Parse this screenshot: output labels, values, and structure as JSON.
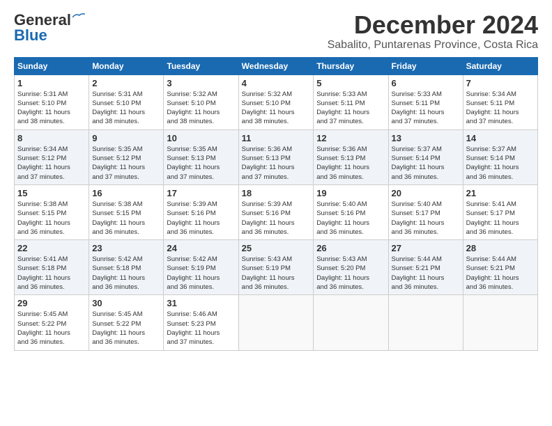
{
  "logo": {
    "line1": "General",
    "line2": "Blue"
  },
  "title": "December 2024",
  "location": "Sabalito, Puntarenas Province, Costa Rica",
  "weekdays": [
    "Sunday",
    "Monday",
    "Tuesday",
    "Wednesday",
    "Thursday",
    "Friday",
    "Saturday"
  ],
  "weeks": [
    [
      {
        "day": "1",
        "detail": "Sunrise: 5:31 AM\nSunset: 5:10 PM\nDaylight: 11 hours\nand 38 minutes."
      },
      {
        "day": "2",
        "detail": "Sunrise: 5:31 AM\nSunset: 5:10 PM\nDaylight: 11 hours\nand 38 minutes."
      },
      {
        "day": "3",
        "detail": "Sunrise: 5:32 AM\nSunset: 5:10 PM\nDaylight: 11 hours\nand 38 minutes."
      },
      {
        "day": "4",
        "detail": "Sunrise: 5:32 AM\nSunset: 5:10 PM\nDaylight: 11 hours\nand 38 minutes."
      },
      {
        "day": "5",
        "detail": "Sunrise: 5:33 AM\nSunset: 5:11 PM\nDaylight: 11 hours\nand 37 minutes."
      },
      {
        "day": "6",
        "detail": "Sunrise: 5:33 AM\nSunset: 5:11 PM\nDaylight: 11 hours\nand 37 minutes."
      },
      {
        "day": "7",
        "detail": "Sunrise: 5:34 AM\nSunset: 5:11 PM\nDaylight: 11 hours\nand 37 minutes."
      }
    ],
    [
      {
        "day": "8",
        "detail": "Sunrise: 5:34 AM\nSunset: 5:12 PM\nDaylight: 11 hours\nand 37 minutes."
      },
      {
        "day": "9",
        "detail": "Sunrise: 5:35 AM\nSunset: 5:12 PM\nDaylight: 11 hours\nand 37 minutes."
      },
      {
        "day": "10",
        "detail": "Sunrise: 5:35 AM\nSunset: 5:13 PM\nDaylight: 11 hours\nand 37 minutes."
      },
      {
        "day": "11",
        "detail": "Sunrise: 5:36 AM\nSunset: 5:13 PM\nDaylight: 11 hours\nand 37 minutes."
      },
      {
        "day": "12",
        "detail": "Sunrise: 5:36 AM\nSunset: 5:13 PM\nDaylight: 11 hours\nand 36 minutes."
      },
      {
        "day": "13",
        "detail": "Sunrise: 5:37 AM\nSunset: 5:14 PM\nDaylight: 11 hours\nand 36 minutes."
      },
      {
        "day": "14",
        "detail": "Sunrise: 5:37 AM\nSunset: 5:14 PM\nDaylight: 11 hours\nand 36 minutes."
      }
    ],
    [
      {
        "day": "15",
        "detail": "Sunrise: 5:38 AM\nSunset: 5:15 PM\nDaylight: 11 hours\nand 36 minutes."
      },
      {
        "day": "16",
        "detail": "Sunrise: 5:38 AM\nSunset: 5:15 PM\nDaylight: 11 hours\nand 36 minutes."
      },
      {
        "day": "17",
        "detail": "Sunrise: 5:39 AM\nSunset: 5:16 PM\nDaylight: 11 hours\nand 36 minutes."
      },
      {
        "day": "18",
        "detail": "Sunrise: 5:39 AM\nSunset: 5:16 PM\nDaylight: 11 hours\nand 36 minutes."
      },
      {
        "day": "19",
        "detail": "Sunrise: 5:40 AM\nSunset: 5:16 PM\nDaylight: 11 hours\nand 36 minutes."
      },
      {
        "day": "20",
        "detail": "Sunrise: 5:40 AM\nSunset: 5:17 PM\nDaylight: 11 hours\nand 36 minutes."
      },
      {
        "day": "21",
        "detail": "Sunrise: 5:41 AM\nSunset: 5:17 PM\nDaylight: 11 hours\nand 36 minutes."
      }
    ],
    [
      {
        "day": "22",
        "detail": "Sunrise: 5:41 AM\nSunset: 5:18 PM\nDaylight: 11 hours\nand 36 minutes."
      },
      {
        "day": "23",
        "detail": "Sunrise: 5:42 AM\nSunset: 5:18 PM\nDaylight: 11 hours\nand 36 minutes."
      },
      {
        "day": "24",
        "detail": "Sunrise: 5:42 AM\nSunset: 5:19 PM\nDaylight: 11 hours\nand 36 minutes."
      },
      {
        "day": "25",
        "detail": "Sunrise: 5:43 AM\nSunset: 5:19 PM\nDaylight: 11 hours\nand 36 minutes."
      },
      {
        "day": "26",
        "detail": "Sunrise: 5:43 AM\nSunset: 5:20 PM\nDaylight: 11 hours\nand 36 minutes."
      },
      {
        "day": "27",
        "detail": "Sunrise: 5:44 AM\nSunset: 5:21 PM\nDaylight: 11 hours\nand 36 minutes."
      },
      {
        "day": "28",
        "detail": "Sunrise: 5:44 AM\nSunset: 5:21 PM\nDaylight: 11 hours\nand 36 minutes."
      }
    ],
    [
      {
        "day": "29",
        "detail": "Sunrise: 5:45 AM\nSunset: 5:22 PM\nDaylight: 11 hours\nand 36 minutes."
      },
      {
        "day": "30",
        "detail": "Sunrise: 5:45 AM\nSunset: 5:22 PM\nDaylight: 11 hours\nand 36 minutes."
      },
      {
        "day": "31",
        "detail": "Sunrise: 5:46 AM\nSunset: 5:23 PM\nDaylight: 11 hours\nand 37 minutes."
      },
      null,
      null,
      null,
      null
    ]
  ]
}
